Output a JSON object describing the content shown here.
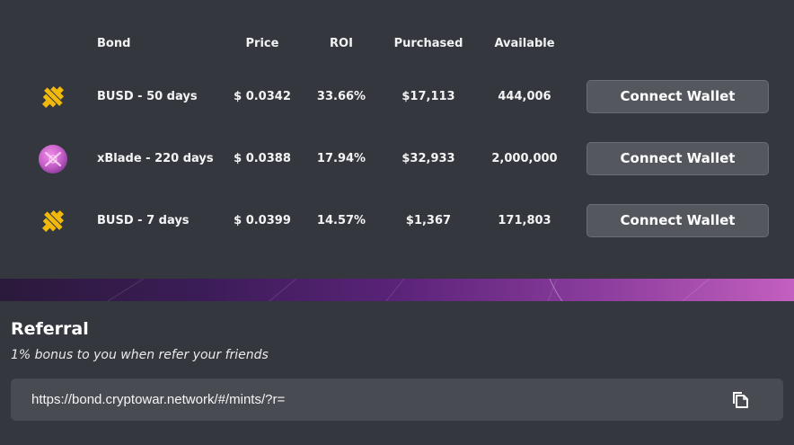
{
  "table": {
    "headers": {
      "bond": "Bond",
      "price": "Price",
      "roi": "ROI",
      "purchased": "Purchased",
      "available": "Available"
    },
    "rows": [
      {
        "icon": "busd-icon",
        "name": "BUSD - 50 days",
        "price": "$ 0.0342",
        "roi": "33.66%",
        "purchased": "$17,113",
        "available": "444,006",
        "action": "Connect Wallet"
      },
      {
        "icon": "xblade-icon",
        "name": "xBlade - 220 days",
        "price": "$ 0.0388",
        "roi": "17.94%",
        "purchased": "$32,933",
        "available": "2,000,000",
        "action": "Connect Wallet"
      },
      {
        "icon": "busd-icon",
        "name": "BUSD - 7 days",
        "price": "$ 0.0399",
        "roi": "14.57%",
        "purchased": "$1,367",
        "available": "171,803",
        "action": "Connect Wallet"
      }
    ]
  },
  "referral": {
    "title": "Referral",
    "subtitle": "1% bonus to you when refer your friends",
    "link": "https://bond.cryptowar.network/#/mints/?r=",
    "copy_icon": "copy-icon"
  },
  "colors": {
    "background": "#34373e",
    "button": "#54575e",
    "input": "#484b52",
    "busd": "#f0b90b",
    "xblade": "#c45fc8"
  }
}
